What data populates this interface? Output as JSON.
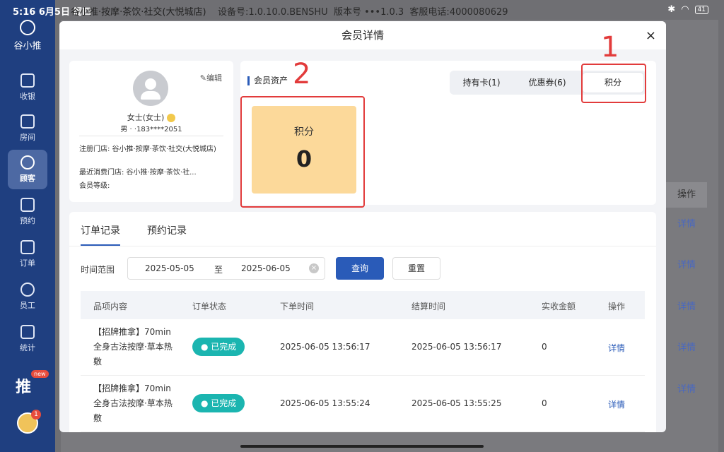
{
  "status_bar": {
    "time": "5:16",
    "date": "6月5日 周四",
    "store": "谷小推·按摩·茶饮·社交(大悦城店)",
    "device": "设备号:1.0.10.0.BENSHU",
    "version": "版本号 •••1.0.3",
    "hotline_label": "客服电话:",
    "hotline": "4000080629",
    "battery": "41"
  },
  "sidebar": {
    "brand": "谷小推",
    "items": [
      {
        "label": "收银",
        "icon": "cashier-icon"
      },
      {
        "label": "房间",
        "icon": "home-icon"
      },
      {
        "label": "顾客",
        "icon": "user-icon"
      },
      {
        "label": "预约",
        "icon": "calendar-icon"
      },
      {
        "label": "订单",
        "icon": "clipboard-icon"
      },
      {
        "label": "员工",
        "icon": "staff-icon"
      },
      {
        "label": "统计",
        "icon": "chart-icon"
      }
    ],
    "new_badge": "new",
    "notif_count": "1"
  },
  "background": {
    "op_header": "操作",
    "detail_links": [
      "详情",
      "详情",
      "详情",
      "详情",
      "详情"
    ]
  },
  "modal": {
    "title": "会员详情",
    "close": "×",
    "profile": {
      "edit_label": "编辑",
      "name": "女士(女士)",
      "gender_phone": "男 ·  ·183****2051",
      "register_store": "注册门店: 谷小推·按摩·茶饮·社交(大悦城店)",
      "last_store": "最近消费门店: 谷小推·按摩·茶饮·社...",
      "member_level": "会员等级:"
    },
    "assets": {
      "title": "会员资产",
      "tabs": [
        "持有卡(1)",
        "优惠券(6)",
        "积分"
      ],
      "active_tab": 2,
      "points_label": "积分",
      "points_value": "0"
    },
    "annotations": {
      "one": "1",
      "two": "2"
    },
    "orders": {
      "tabs": [
        "订单记录",
        "预约记录"
      ],
      "range_label": "时间范围",
      "start_date": "2025-05-05",
      "to": "至",
      "end_date": "2025-06-05",
      "query_label": "查询",
      "reset_label": "重置",
      "columns": [
        "品项内容",
        "订单状态",
        "下单时间",
        "结算时间",
        "实收金额",
        "操作"
      ],
      "rows": [
        {
          "item": "【招牌推拿】70min全身古法按摩·草本热敷",
          "status": "● 已完成",
          "order_time": "2025-06-05 13:56:17",
          "settle_time": "2025-06-05 13:56:17",
          "amount": "0",
          "op": "详情"
        },
        {
          "item": "【招牌推拿】70min全身古法按摩·草本热敷",
          "status": "● 已完成",
          "order_time": "2025-06-05 13:55:24",
          "settle_time": "2025-06-05 13:55:25",
          "amount": "0",
          "op": "详情"
        }
      ]
    }
  }
}
